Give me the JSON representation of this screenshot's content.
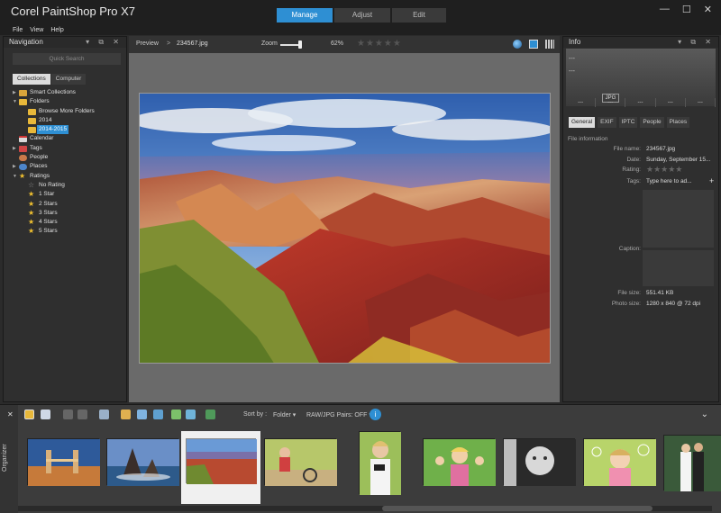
{
  "app": {
    "title": "Corel PaintShop Pro X7"
  },
  "mode_tabs": [
    {
      "label": "Manage",
      "active": true
    },
    {
      "label": "Adjust",
      "active": false
    },
    {
      "label": "Edit",
      "active": false
    }
  ],
  "window_controls": {
    "minimize": "—",
    "maximize": "☐",
    "close": "✕"
  },
  "menu": [
    "File",
    "View",
    "Help"
  ],
  "nav": {
    "title": "Navigation",
    "panel_controls": "▾ ⧉ ✕",
    "quick_search_placeholder": "Quick Search",
    "tabs": [
      {
        "label": "Collections",
        "active": true
      },
      {
        "label": "Computer",
        "active": false
      }
    ],
    "tree": [
      {
        "label": "Smart Collections",
        "icon": "smart-collections-icon",
        "expander": "▶"
      },
      {
        "label": "Folders",
        "icon": "folder-icon",
        "expander": "▼"
      },
      {
        "label": "Browse More Folders",
        "icon": "folder-icon"
      },
      {
        "label": "2014",
        "icon": "folder-icon"
      },
      {
        "label": "2014-2015",
        "icon": "folder-icon",
        "selected": true
      },
      {
        "label": "Calendar",
        "icon": "calendar-icon"
      },
      {
        "label": "Tags",
        "icon": "tag-icon",
        "expander": "▶"
      },
      {
        "label": "People",
        "icon": "people-icon"
      },
      {
        "label": "Places",
        "icon": "places-icon",
        "expander": "▶"
      },
      {
        "label": "Ratings",
        "icon": "star-icon",
        "expander": "▼"
      },
      {
        "label": "No Rating",
        "icon": "empty-star-icon"
      },
      {
        "label": "1 Star",
        "icon": "star-icon"
      },
      {
        "label": "2 Stars",
        "icon": "star-icon"
      },
      {
        "label": "3 Stars",
        "icon": "star-icon"
      },
      {
        "label": "4 Stars",
        "icon": "star-icon"
      },
      {
        "label": "5 Stars",
        "icon": "star-icon"
      }
    ]
  },
  "preview": {
    "label": "Preview",
    "arrow": ">",
    "filename": "234567.jpg",
    "zoom_label": "Zoom",
    "zoom_value": "62%",
    "rating_stars": "★★★★★",
    "rating": 0
  },
  "info": {
    "title": "Info",
    "panel_controls": "▾ ⧉ ✕",
    "thumb_dashes": [
      "---",
      "---"
    ],
    "format_badge": "JPG",
    "cells": [
      "---",
      "---",
      "---",
      "---",
      "---"
    ],
    "tabs": [
      {
        "label": "General",
        "active": true
      },
      {
        "label": "EXIF",
        "active": false
      },
      {
        "label": "IPTC",
        "active": false
      },
      {
        "label": "People",
        "active": false
      },
      {
        "label": "Places",
        "active": false
      }
    ],
    "section": "File information",
    "file_name_label": "File name:",
    "file_name": "234567.jpg",
    "date_label": "Date:",
    "date": "Sunday, September 15...",
    "rating_label": "Rating:",
    "rating_stars": "★★★★★",
    "tags_label": "Tags:",
    "tags_placeholder": "Type here to ad...",
    "tags_add": "+",
    "caption_label": "Caption:",
    "file_size_label": "File size:",
    "file_size": "551.41 KB",
    "photo_size_label": "Photo size:",
    "photo_size": "1280 x 840 @ 72 dpi"
  },
  "organizer": {
    "label": "Organizer",
    "close": "✕",
    "sort_by_label": "Sort by :",
    "sort_by_value": "Folder ▾",
    "raw_jpg": "RAW/JPG Pairs: OFF ▾",
    "info_button": "i",
    "collapse": "⌄",
    "thumbnails": [
      "london-tower-bridge",
      "sea-stacks-sunset",
      "grand-canyon",
      "family-cycling",
      "woman-with-camera",
      "child-waving",
      "baby-black-and-white",
      "girl-with-bubbles",
      "wedding-couple"
    ],
    "selected_index": 2
  },
  "colors": {
    "accent": "#2e8fd3",
    "panel": "#2f2f2f",
    "chrome": "#1f1f1f",
    "preview_bg": "#6a6a6a"
  }
}
